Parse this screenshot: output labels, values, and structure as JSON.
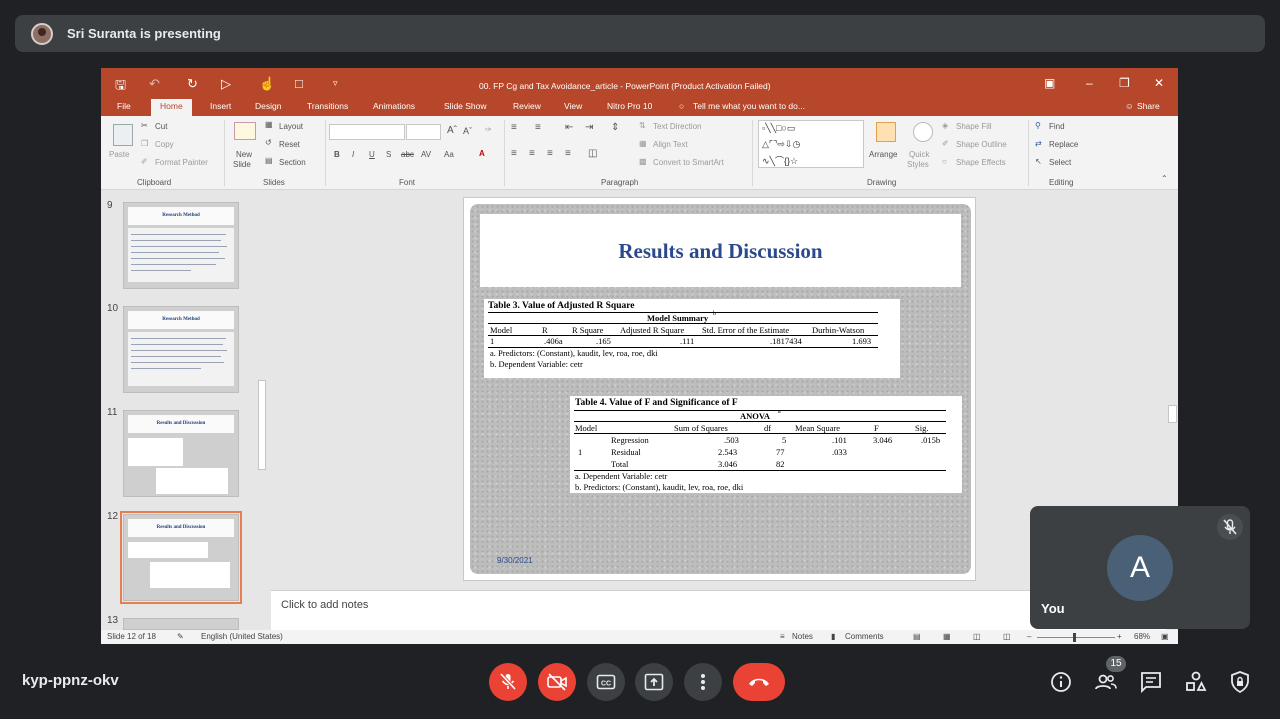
{
  "meet": {
    "presenting_label": "Sri Suranta is presenting",
    "meeting_code": "kyp-ppnz-okv",
    "self_initial": "A",
    "self_name": "You",
    "participants_count": "15",
    "controls": [
      "mic-off",
      "camera-off",
      "captions",
      "present",
      "more",
      "leave"
    ],
    "right_controls": [
      "info",
      "people",
      "chat",
      "activities",
      "host-controls"
    ],
    "colors": {
      "danger": "#ea4335",
      "surface": "#3c4043",
      "background": "#202124"
    }
  },
  "ppt": {
    "window_title": "00. FP Cg and Tax Avoidance_article - PowerPoint (Product Activation Failed)",
    "tabs": [
      "File",
      "Home",
      "Insert",
      "Design",
      "Transitions",
      "Animations",
      "Slide Show",
      "Review",
      "View",
      "Nitro Pro 10"
    ],
    "tell_me": "Tell me what you want to do...",
    "share": "Share",
    "ribbon": {
      "clipboard": {
        "paste": "Paste",
        "cut": "Cut",
        "copy": "Copy",
        "format_painter": "Format Painter",
        "group": "Clipboard"
      },
      "slides": {
        "new_slide": "New",
        "new_slide2": "Slide",
        "layout": "Layout",
        "reset": "Reset",
        "section": "Section",
        "group": "Slides"
      },
      "font": {
        "group": "Font"
      },
      "paragraph": {
        "text_direction": "Text Direction",
        "align_text": "Align Text",
        "convert": "Convert to SmartArt",
        "group": "Paragraph"
      },
      "drawing": {
        "arrange": "Arrange",
        "quick_styles": "Quick",
        "quick_styles2": "Styles",
        "shape_fill": "Shape Fill",
        "shape_outline": "Shape Outline",
        "shape_effects": "Shape Effects",
        "group": "Drawing"
      },
      "editing": {
        "find": "Find",
        "replace": "Replace",
        "select": "Select",
        "group": "Editing"
      }
    },
    "thumbnails": [
      {
        "num": "9",
        "title": "Research Method"
      },
      {
        "num": "10",
        "title": "Research Method"
      },
      {
        "num": "11",
        "title": "Results and Discussion"
      },
      {
        "num": "12",
        "title": "Results and Discussion"
      },
      {
        "num": "13",
        "title": ""
      }
    ],
    "slide": {
      "title": "Results and Discussion",
      "date": "9/30/2021",
      "table3": {
        "caption": "Table 3. Value of Adjusted R Square",
        "subtitle": "Model Summary",
        "headers": [
          "Model",
          "R",
          "R Square",
          "Adjusted R Square",
          "Std. Error of the Estimate",
          "Durbin-Watson"
        ],
        "row": [
          "1",
          ".406a",
          ".165",
          ".111",
          ".1817434",
          "1.693"
        ],
        "note_a": "a. Predictors: (Constant), kaudit, lev, roa, roe, dki",
        "note_b": "b. Dependent Variable: cetr"
      },
      "table4": {
        "caption": "Table 4. Value of F and Significance of F",
        "subtitle": "ANOVA",
        "headers": [
          "Model",
          "Sum of Squares",
          "df",
          "Mean Square",
          "F",
          "Sig."
        ],
        "model": "1",
        "rows": [
          [
            "Regression",
            ".503",
            "5",
            ".101",
            "3.046",
            ".015b"
          ],
          [
            "Residual",
            "2.543",
            "77",
            ".033",
            "",
            ""
          ],
          [
            "Total",
            "3.046",
            "82",
            "",
            "",
            ""
          ]
        ],
        "note_a": "a. Dependent Variable: cetr",
        "note_b": "b. Predictors: (Constant), kaudit, lev, roa, roe, dki"
      }
    },
    "notes_placeholder": "Click to add notes",
    "status": {
      "slide_of": "Slide 12 of 18",
      "language": "English (United States)",
      "notes": "Notes",
      "comments": "Comments",
      "zoom": "68%"
    },
    "colors": {
      "accent": "#b7472a",
      "title_blue": "#2b4a8c"
    }
  }
}
